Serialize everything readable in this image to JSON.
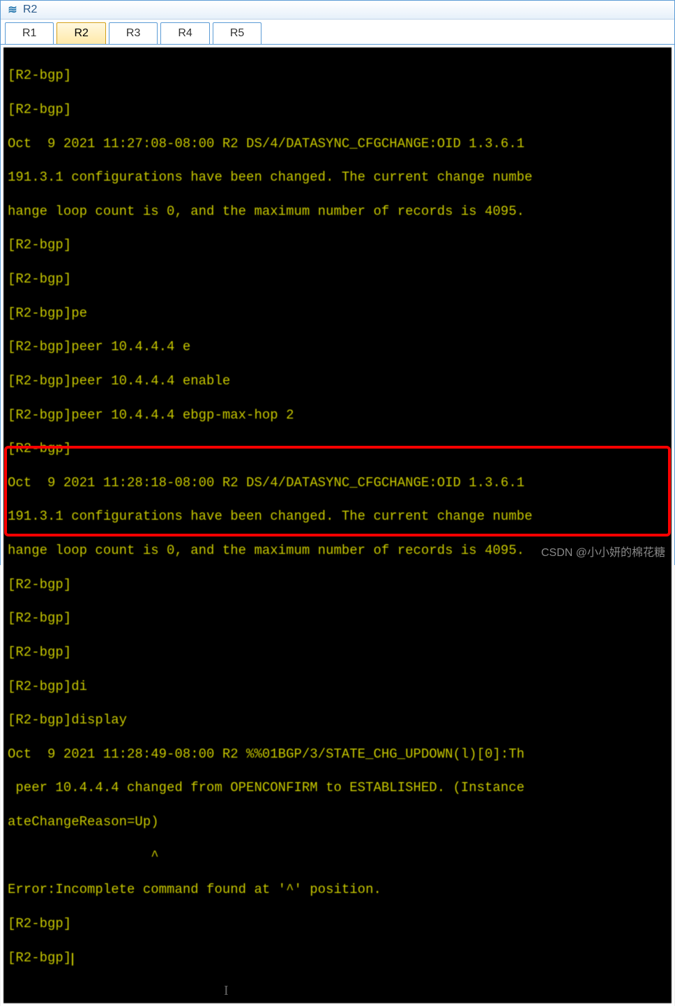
{
  "window": {
    "title": "R2",
    "icon": "eNSP"
  },
  "tabs": [
    {
      "label": "R1",
      "active": false
    },
    {
      "label": "R2",
      "active": true
    },
    {
      "label": "R3",
      "active": false
    },
    {
      "label": "R4",
      "active": false
    },
    {
      "label": "R5",
      "active": false
    }
  ],
  "terminal": {
    "lines": [
      "[R2-bgp]",
      "[R2-bgp]",
      "Oct  9 2021 11:27:08-08:00 R2 DS/4/DATASYNC_CFGCHANGE:OID 1.3.6.1",
      "191.3.1 configurations have been changed. The current change numbe",
      "hange loop count is 0, and the maximum number of records is 4095.",
      "[R2-bgp]",
      "[R2-bgp]",
      "[R2-bgp]pe",
      "[R2-bgp]peer 10.4.4.4 e",
      "[R2-bgp]peer 10.4.4.4 enable",
      "[R2-bgp]peer 10.4.4.4 ebgp-max-hop 2",
      "[R2-bgp]",
      "Oct  9 2021 11:28:18-08:00 R2 DS/4/DATASYNC_CFGCHANGE:OID 1.3.6.1",
      "191.3.1 configurations have been changed. The current change numbe",
      "hange loop count is 0, and the maximum number of records is 4095.",
      "[R2-bgp]",
      "[R2-bgp]",
      "[R2-bgp]",
      "[R2-bgp]di",
      "[R2-bgp]display",
      "Oct  9 2021 11:28:49-08:00 R2 %%01BGP/3/STATE_CHG_UPDOWN(l)[0]:Th",
      " peer 10.4.4.4 changed from OPENCONFIRM to ESTABLISHED. (Instance",
      "ateChangeReason=Up)"
    ],
    "caret_line": "                  ^",
    "error_line": "Error:Incomplete command found at '^' position.",
    "prompt1": "[R2-bgp]",
    "prompt2": "[R2-bgp]"
  },
  "watermark": "CSDN @小小妍的棉花糖"
}
